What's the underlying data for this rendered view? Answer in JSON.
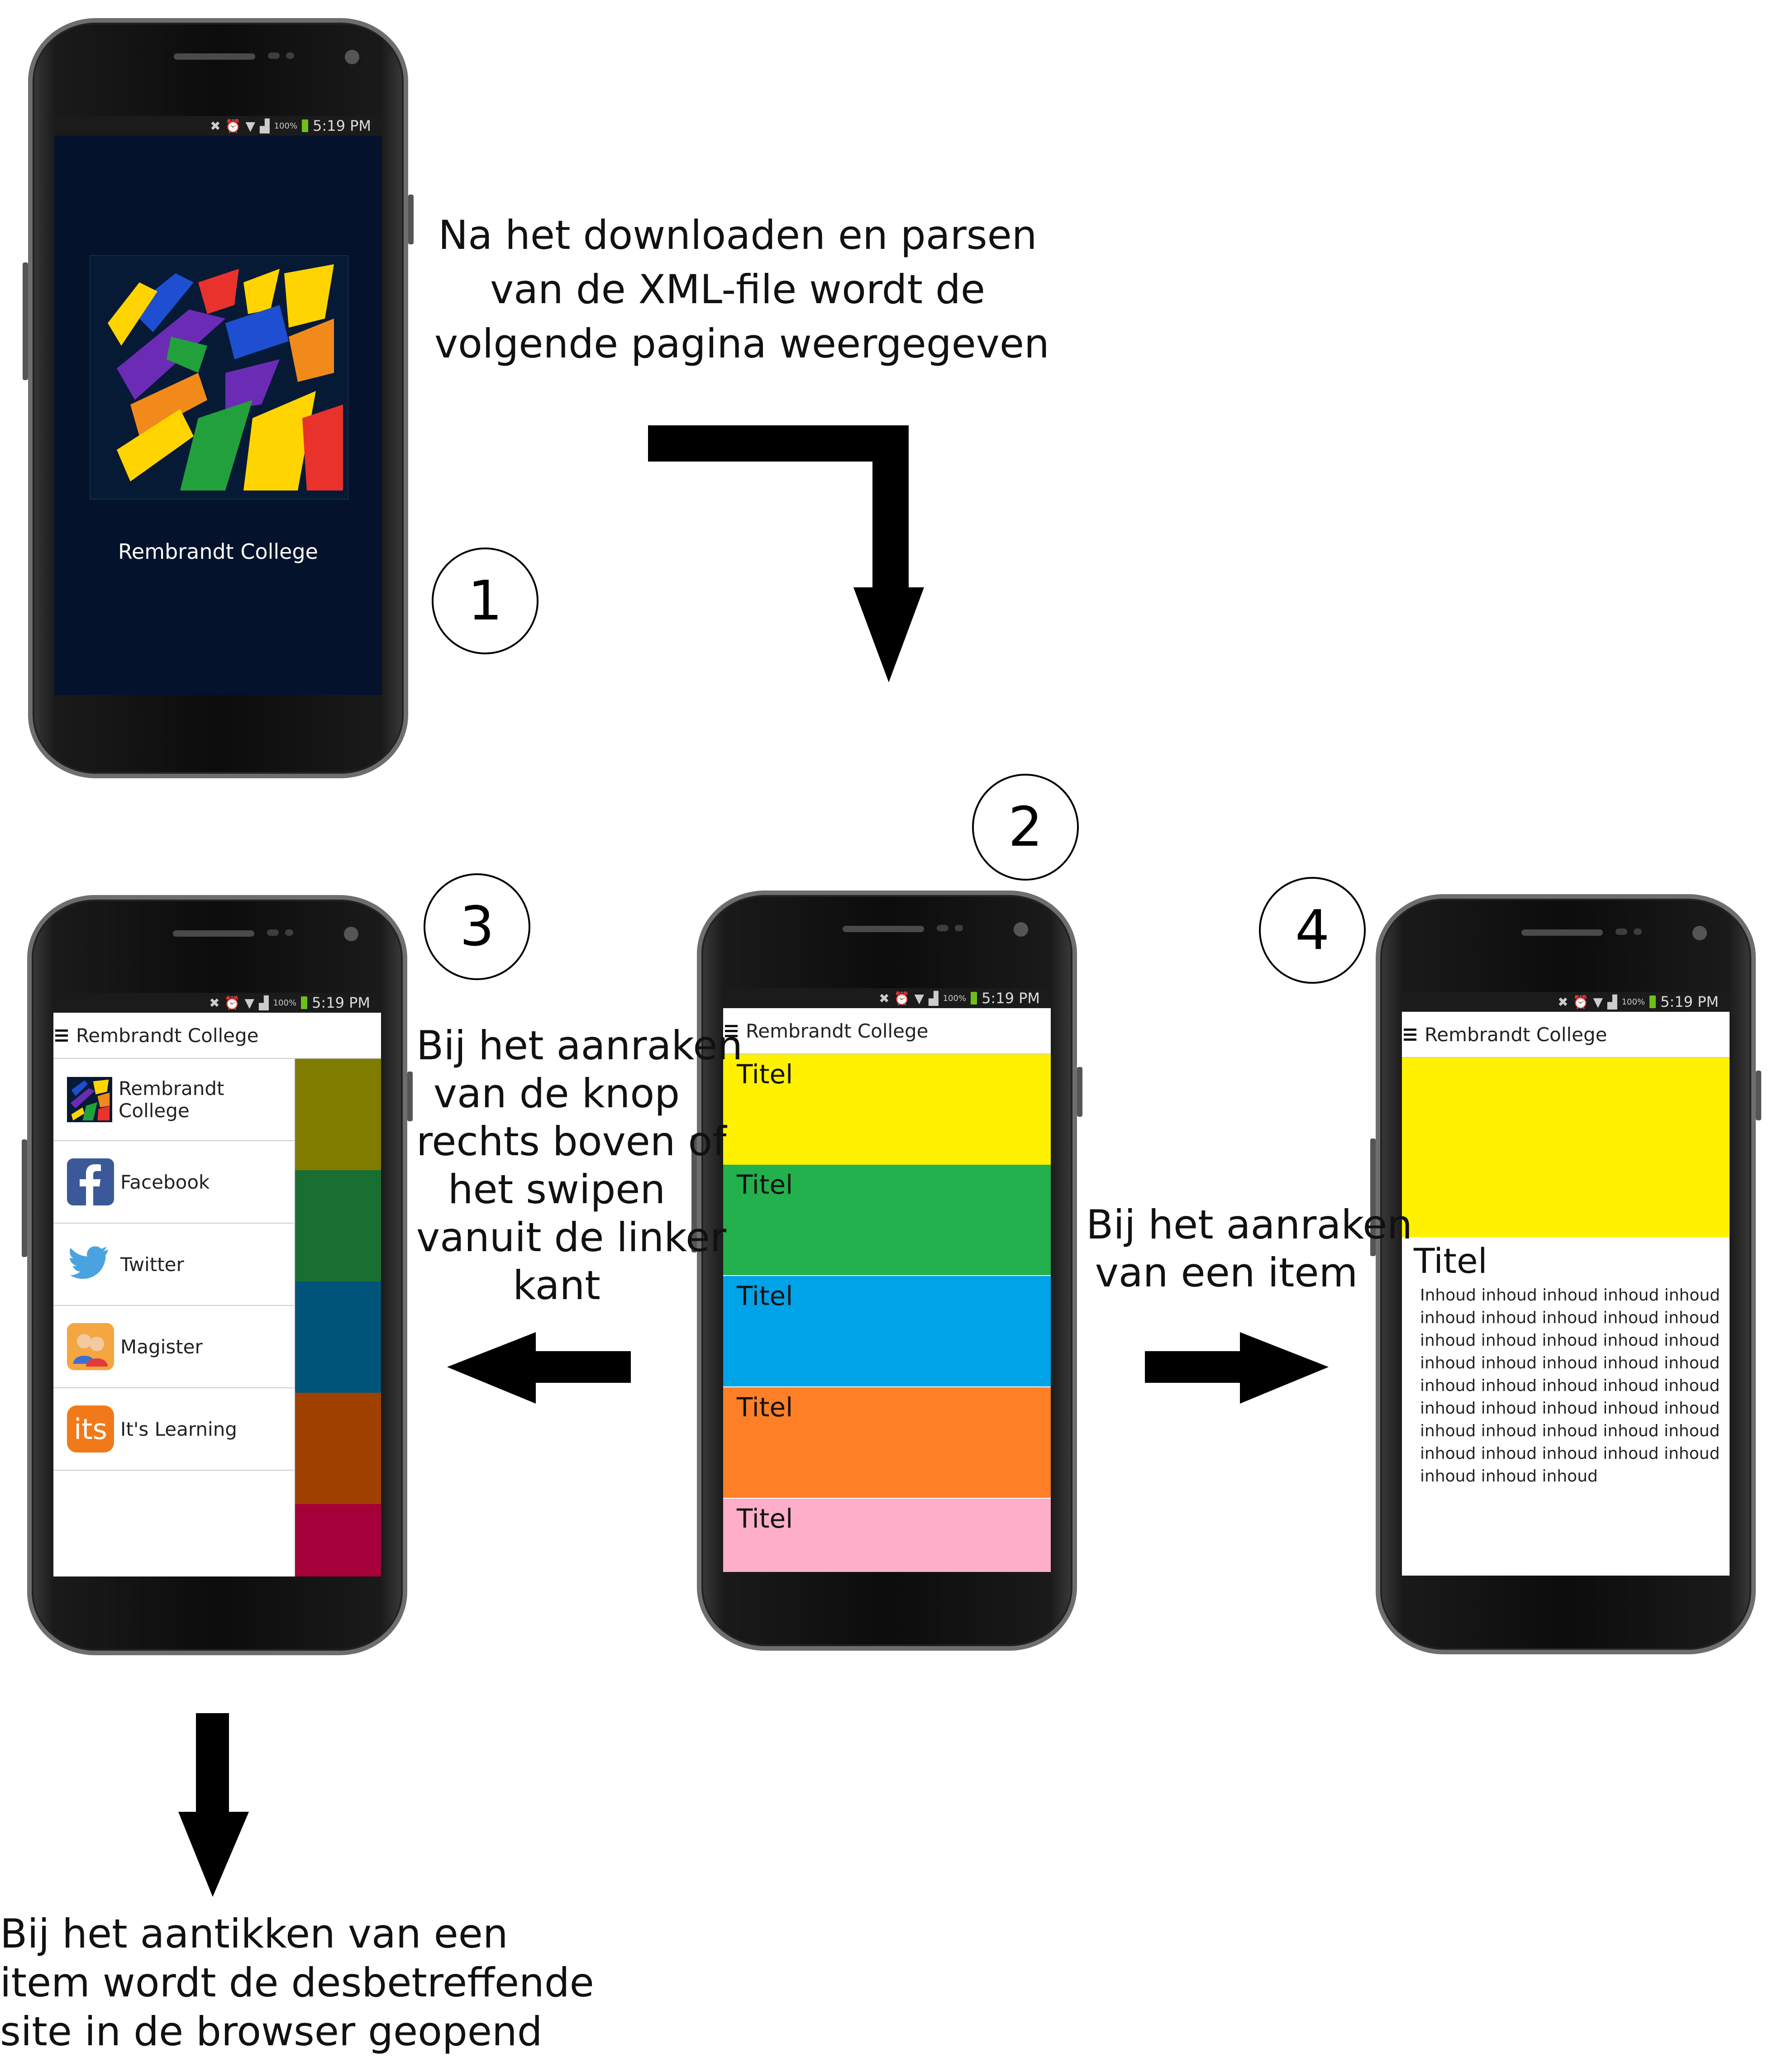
{
  "status_bar": {
    "percent": "100%",
    "time": "5:19 PM"
  },
  "app_title": "Rembrandt College",
  "step_numbers": [
    "1",
    "2",
    "3",
    "4"
  ],
  "captions": {
    "top": [
      "Na het downloaden en parsen",
      "van de XML-file wordt de",
      "volgende pagina weergegeven"
    ],
    "left": [
      "Bij het aanraken",
      "van de knop",
      "rechts boven of",
      "het swipen",
      "vanuit de linker",
      "kant"
    ],
    "right": [
      "Bij het aanraken",
      "van een item"
    ],
    "bottom": [
      "Bij het aantikken van een",
      "item wordt de desbetreffende",
      "site in de browser geopend"
    ]
  },
  "splash": {
    "label": "Rembrandt College"
  },
  "list_tiles": [
    {
      "title": "Titel",
      "color": "#fff100"
    },
    {
      "title": "Titel",
      "color": "#22b14c"
    },
    {
      "title": "Titel",
      "color": "#00a2e8"
    },
    {
      "title": "Titel",
      "color": "#ff7f27"
    },
    {
      "title": "Titel",
      "color": "#ffaec9"
    }
  ],
  "drawer": {
    "items": [
      {
        "label": "Rembrandt College",
        "icon": "school-logo-icon"
      },
      {
        "label": "Facebook",
        "icon": "facebook-icon"
      },
      {
        "label": "Twitter",
        "icon": "twitter-icon"
      },
      {
        "label": "Magister",
        "icon": "magister-icon"
      },
      {
        "label": "It's Learning",
        "icon": "itslearning-icon",
        "icon_text": "its"
      }
    ],
    "background_tile_colors": [
      "#807c00",
      "#196f32",
      "#00547a",
      "#a14100",
      "#a5003a"
    ]
  },
  "detail": {
    "color": "#fff100",
    "title": "Titel",
    "body_lines": [
      "Inhoud inhoud inhoud inhoud inhoud",
      "inhoud inhoud inhoud inhoud inhoud",
      "inhoud inhoud inhoud inhoud inhoud",
      "inhoud inhoud inhoud inhoud inhoud",
      "inhoud inhoud inhoud inhoud inhoud",
      "inhoud inhoud inhoud inhoud inhoud",
      "inhoud inhoud inhoud inhoud inhoud",
      "inhoud inhoud inhoud inhoud inhoud",
      "inhoud inhoud inhoud"
    ]
  }
}
